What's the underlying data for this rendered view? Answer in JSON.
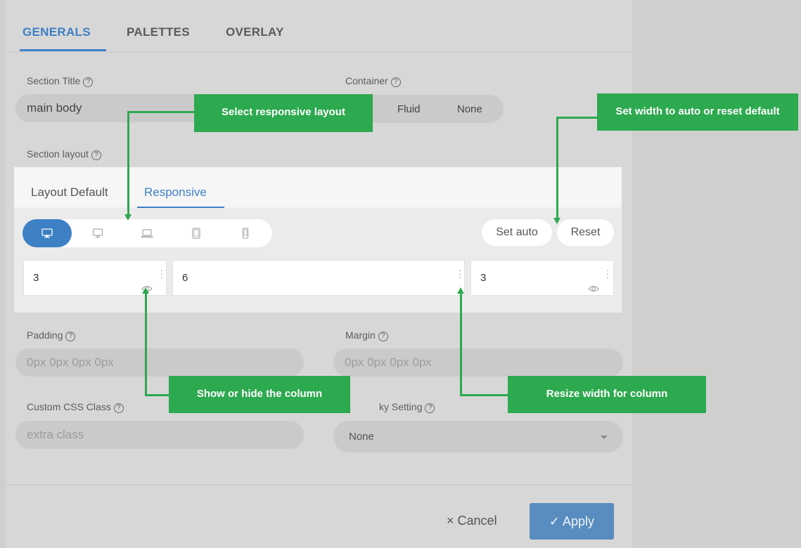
{
  "tabs": [
    "GENERALS",
    "PALETTES",
    "OVERLAY"
  ],
  "fields": {
    "section_title_label": "Section Title",
    "section_title_value": "main body",
    "container_label": "Container",
    "container_options": [
      "Fluid",
      "None"
    ],
    "section_layout_label": "Section layout",
    "padding_label": "Padding",
    "padding_placeholder": "0px 0px 0px 0px",
    "margin_label": "Margin",
    "margin_placeholder": "0px 0px 0px 0px",
    "custom_css_label": "Custom CSS Class",
    "custom_css_placeholder": "extra class",
    "sticky_label": "ky Setting",
    "sticky_value": "None",
    "help_glyph": "?"
  },
  "layout": {
    "tabs": [
      "Layout Default",
      "Responsive"
    ],
    "devices": [
      "desktop-icon",
      "monitor-icon",
      "laptop-icon",
      "tablet-icon",
      "mobile-icon"
    ],
    "set_auto": "Set auto",
    "reset": "Reset",
    "columns": [
      "3",
      "6",
      "3"
    ]
  },
  "callouts": {
    "select_layout": "Select responsive layout",
    "set_width": "Set width to auto or reset default",
    "show_hide": "Show or hide the column",
    "resize": "Resize width for column"
  },
  "footer": {
    "cancel": "Cancel",
    "cancel_glyph": "×",
    "apply": "Apply",
    "apply_glyph": "✓"
  },
  "colors": {
    "accent": "#3d80c4",
    "callout": "#2da94f",
    "apply": "#5a8dbf"
  }
}
